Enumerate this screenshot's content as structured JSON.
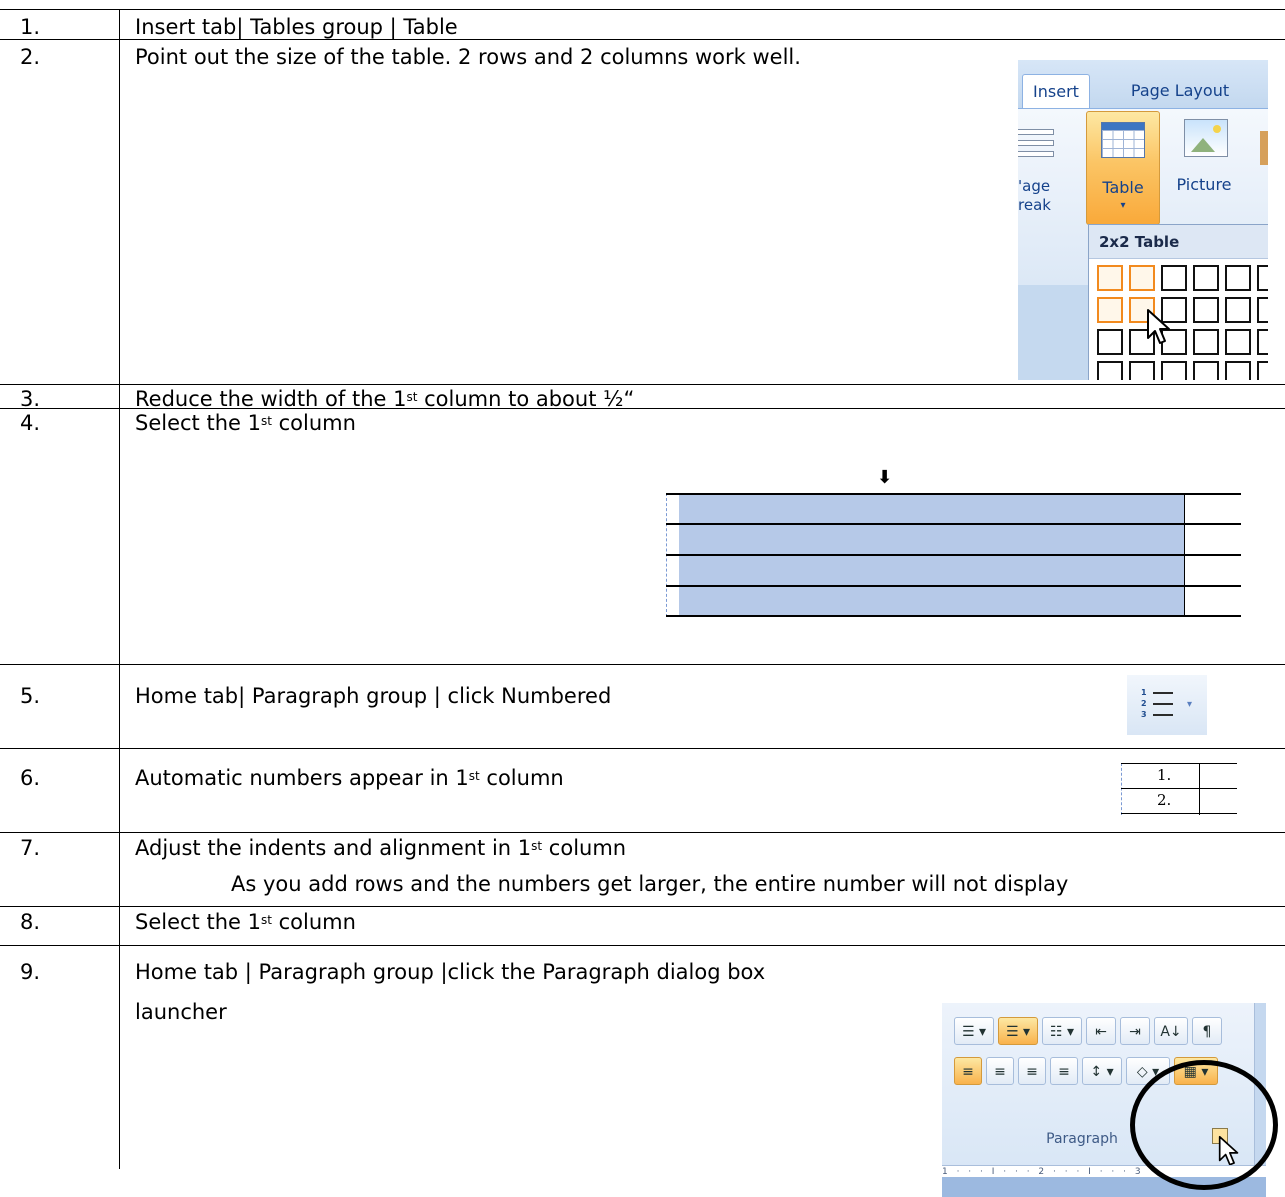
{
  "steps": [
    {
      "num": "1.",
      "text": "Insert tab| Tables group | Table"
    },
    {
      "num": "2.",
      "text": "Point out the size of the table. 2 rows and 2 columns work well."
    },
    {
      "num": "3.",
      "text_before": "Reduce the width of the 1",
      "sup": "st",
      "text_after": " column to about ½“"
    },
    {
      "num": "4.",
      "text_before": "Select the 1",
      "sup": "st",
      "text_after": " column"
    },
    {
      "num": "5.",
      "text": "Home tab| Paragraph group | click Numbered"
    },
    {
      "num": "6.",
      "text_before": "Automatic  numbers appear in 1",
      "sup": "st",
      "text_after": " column"
    },
    {
      "num": "7.",
      "text_before": "Adjust the indents and alignment in 1",
      "sup": "st",
      "text_after": " column",
      "note": "As you add rows and the numbers get larger, the entire number will not display"
    },
    {
      "num": "8.",
      "text_before": "Select the 1",
      "sup": "st",
      "text_after": " column"
    },
    {
      "num": "9.",
      "text_line1": "Home tab | Paragraph group |click the Paragraph dialog box",
      "text_line2": "launcher"
    }
  ],
  "ribbon": {
    "tabs": [
      "Insert",
      "Page Layout"
    ],
    "page_break_label_1": "'age",
    "page_break_label_2": "reak",
    "table_label": "Table",
    "table_arrow": "▾",
    "picture_label": "Picture",
    "dropdown_header": "2x2 Table",
    "grid_rows": 4,
    "grid_cols": 6,
    "highlight_rows": 2,
    "highlight_cols": 2,
    "accent_color": "#f28a1e"
  },
  "column_select": {
    "arrow": "⬇",
    "rows": 4,
    "highlight_color": "#b6c9e8"
  },
  "numbered_button": {
    "digits": [
      "1",
      "2",
      "3"
    ],
    "arrow": "▾"
  },
  "mini_table": {
    "numbers": [
      "1.",
      "2."
    ]
  },
  "paragraph_group": {
    "row1": [
      "☰ ▾",
      "☰ ▾",
      "☷ ▾",
      "⇤",
      "⇥",
      "A↓",
      "¶"
    ],
    "row2": [
      "≡",
      "≡",
      "≡",
      "≡",
      "↕ ▾",
      "◇ ▾",
      "▦ ▾"
    ],
    "label": "Paragraph",
    "ruler": "1 · · · I · · · 2 · · · I · · · 3"
  }
}
